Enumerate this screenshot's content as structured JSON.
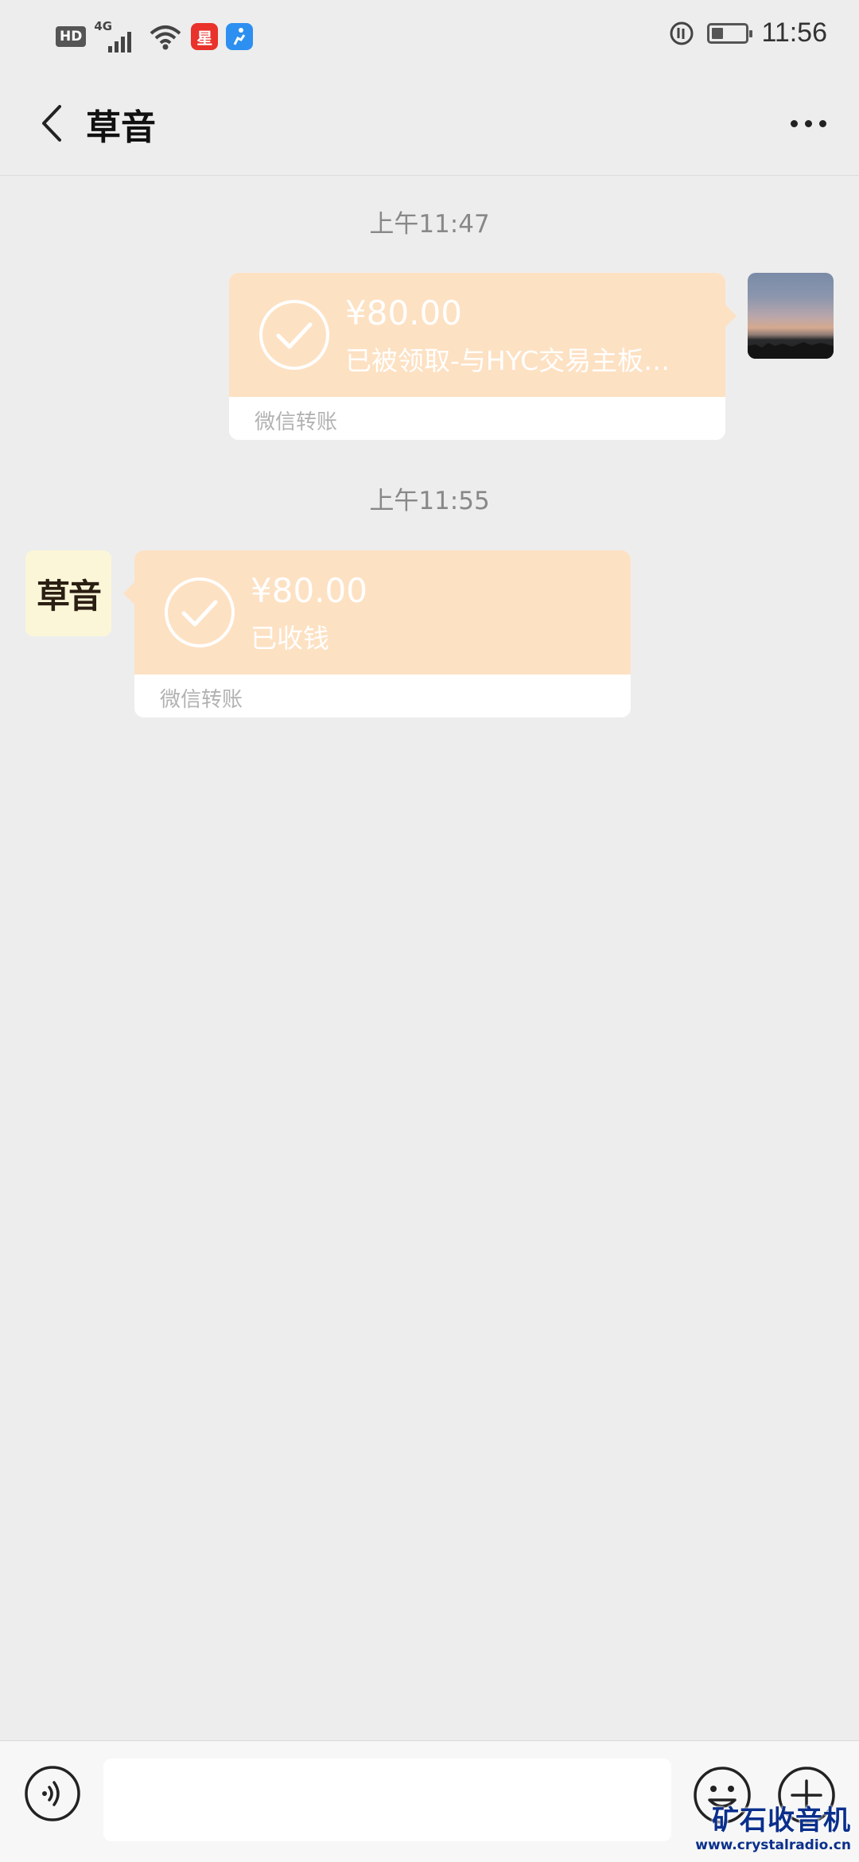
{
  "status_bar": {
    "hd_label": "HD",
    "network_label": "4G",
    "time": "11:56",
    "battery_fraction": 0.35
  },
  "nav": {
    "title": "草音",
    "back_icon": "chevron-left-icon",
    "more_icon": "more-dots-icon"
  },
  "messages": [
    {
      "timestamp": "上午11:47",
      "side": "right",
      "amount": "¥80.00",
      "description": "已被领取-与HYC交易主板…",
      "footer": "微信转账"
    },
    {
      "timestamp": "上午11:55",
      "side": "left",
      "avatar_text": "草音",
      "amount": "¥80.00",
      "description": "已收钱",
      "footer": "微信转账"
    }
  ],
  "input_bar": {
    "voice_icon": "voice-icon",
    "emoji_icon": "emoji-icon",
    "plus_icon": "plus-icon",
    "input_value": ""
  },
  "watermark": {
    "main": "矿石收音机",
    "sub": "www.crystalradio.cn"
  },
  "colors": {
    "background": "#ededed",
    "transfer_bubble": "#fde1c3",
    "timestamp_text": "#888888",
    "footer_text": "#b2b2b2"
  }
}
